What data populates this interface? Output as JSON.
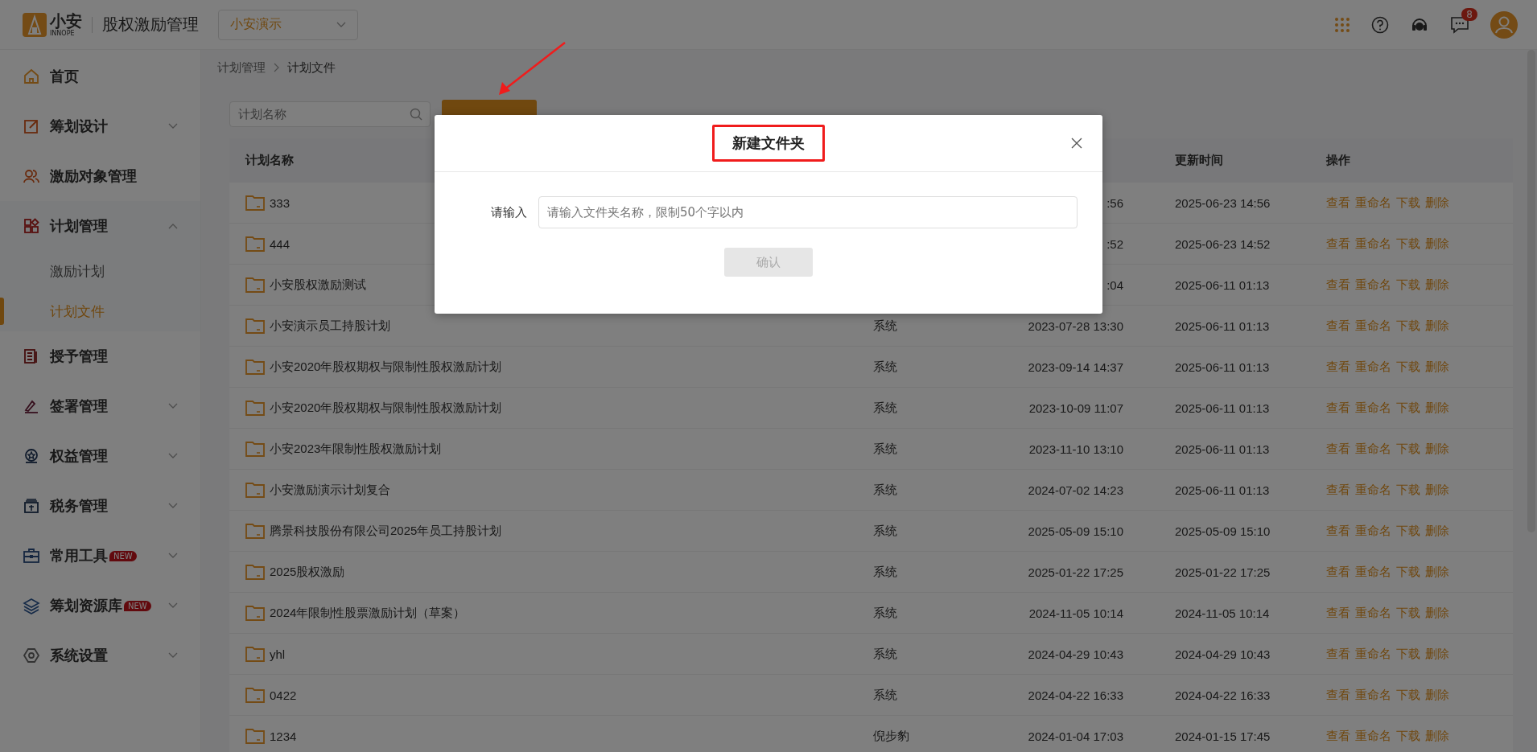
{
  "header": {
    "logo_text": "小安",
    "logo_sub": "INNOPE",
    "app_title": "股权激励管理",
    "company_select": {
      "value": "小安演示"
    },
    "message_badge": "8"
  },
  "sidebar": {
    "items": [
      {
        "kind": "link",
        "label": "首页"
      },
      {
        "kind": "group",
        "label": "筹划设计",
        "expanded": false
      },
      {
        "kind": "link",
        "label": "激励对象管理"
      },
      {
        "kind": "group",
        "label": "计划管理",
        "expanded": true,
        "children": [
          {
            "label": "激励计划",
            "selected": false
          },
          {
            "label": "计划文件",
            "selected": true
          }
        ]
      },
      {
        "kind": "link",
        "label": "授予管理"
      },
      {
        "kind": "group",
        "label": "签署管理",
        "expanded": false
      },
      {
        "kind": "group",
        "label": "权益管理",
        "expanded": false
      },
      {
        "kind": "group",
        "label": "税务管理",
        "expanded": false
      },
      {
        "kind": "group",
        "label": "常用工具",
        "expanded": false,
        "badge": "NEW"
      },
      {
        "kind": "group",
        "label": "筹划资源库",
        "expanded": false,
        "badge": "NEW"
      },
      {
        "kind": "group",
        "label": "系统设置",
        "expanded": false
      }
    ]
  },
  "breadcrumb": [
    "计划管理",
    "计划文件"
  ],
  "search": {
    "placeholder": "计划名称"
  },
  "table": {
    "columns": [
      "计划名称",
      "",
      "",
      "更新时间",
      "操作"
    ],
    "rows": [
      {
        "name": "333",
        "created": ":56",
        "updated": "2025-06-23 14:56",
        "actions": [
          "查看",
          "重命名",
          "下载",
          "删除"
        ]
      },
      {
        "name": "444",
        "created": ":52",
        "updated": "2025-06-23 14:52",
        "actions": [
          "查看",
          "重命名",
          "下载",
          "删除"
        ]
      },
      {
        "name": "小安股权激励测试",
        "created": ":04",
        "updated": "2025-06-11 01:13",
        "actions": [
          "查看",
          "重命名",
          "下载",
          "删除"
        ]
      },
      {
        "name": "小安演示员工持股计划",
        "creator": "系统",
        "created": "2023-07-28 13:30",
        "updated": "2025-06-11 01:13",
        "actions": [
          "查看",
          "重命名",
          "下载",
          "删除"
        ]
      },
      {
        "name": "小安2020年股权期权与限制性股权激励计划",
        "creator": "系统",
        "created": "2023-09-14 14:37",
        "updated": "2025-06-11 01:13",
        "actions": [
          "查看",
          "重命名",
          "下载",
          "删除"
        ]
      },
      {
        "name": "小安2020年股权期权与限制性股权激励计划",
        "creator": "系统",
        "created": "2023-10-09 11:07",
        "updated": "2025-06-11 01:13",
        "actions": [
          "查看",
          "重命名",
          "下载",
          "删除"
        ]
      },
      {
        "name": "小安2023年限制性股权激励计划",
        "creator": "系统",
        "created": "2023-11-10 13:10",
        "updated": "2025-06-11 01:13",
        "actions": [
          "查看",
          "重命名",
          "下载",
          "删除"
        ]
      },
      {
        "name": "小安激励演示计划复合",
        "creator": "系统",
        "created": "2024-07-02 14:23",
        "updated": "2025-06-11 01:13",
        "actions": [
          "查看",
          "重命名",
          "下载",
          "删除"
        ]
      },
      {
        "name": "腾景科技股份有限公司2025年员工持股计划",
        "creator": "系统",
        "created": "2025-05-09 15:10",
        "updated": "2025-05-09 15:10",
        "actions": [
          "查看",
          "重命名",
          "下载",
          "删除"
        ]
      },
      {
        "name": "2025股权激励",
        "creator": "系统",
        "created": "2025-01-22 17:25",
        "updated": "2025-01-22 17:25",
        "actions": [
          "查看",
          "重命名",
          "下载",
          "删除"
        ]
      },
      {
        "name": "2024年限制性股票激励计划（草案）",
        "creator": "系统",
        "created": "2024-11-05 10:14",
        "updated": "2024-11-05 10:14",
        "actions": [
          "查看",
          "重命名",
          "下载",
          "删除"
        ]
      },
      {
        "name": "yhl",
        "creator": "系统",
        "created": "2024-04-29 10:43",
        "updated": "2024-04-29 10:43",
        "actions": [
          "查看",
          "重命名",
          "下载",
          "删除"
        ]
      },
      {
        "name": "0422",
        "creator": "系统",
        "created": "2024-04-22 16:33",
        "updated": "2024-04-22 16:33",
        "actions": [
          "查看",
          "重命名",
          "下载",
          "删除"
        ]
      },
      {
        "name": "1234",
        "creator": "倪步豹",
        "created": "2024-01-04 17:03",
        "updated": "2024-01-15 17:45",
        "actions": [
          "查看",
          "重命名",
          "下载",
          "删除"
        ]
      }
    ]
  },
  "dialog": {
    "title": "新建文件夹",
    "field_label": "请输入",
    "placeholder": "请输入文件夹名称，限制50个字以内",
    "confirm": {
      "label": "确认",
      "disabled": true
    }
  }
}
